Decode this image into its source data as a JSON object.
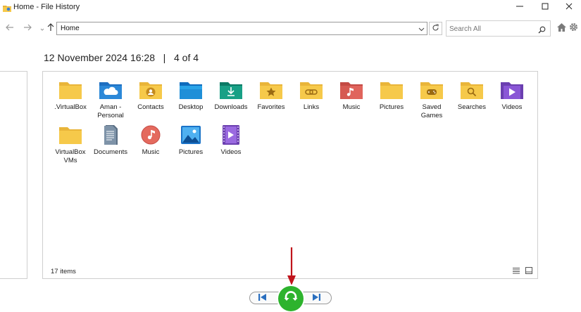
{
  "window": {
    "title": "Home - File History",
    "controls": {
      "minimize_icon": "minimize-icon",
      "maximize_icon": "maximize-icon",
      "close_icon": "close-icon"
    }
  },
  "toolbar": {
    "address_value": "Home",
    "search_placeholder": "Search All",
    "icons": [
      "back-arrow-icon",
      "forward-arrow-icon",
      "recent-chevron-icon",
      "up-arrow-icon",
      "refresh-icon",
      "search-icon",
      "home-icon",
      "gear-icon"
    ]
  },
  "backup": {
    "date": "12 November 2024 16:28",
    "separator": "|",
    "position": "4 of 4"
  },
  "items": [
    {
      "label": ".VirtualBox",
      "icon": "folder-icon"
    },
    {
      "label": "Aman - Personal",
      "icon": "onedrive-folder-icon"
    },
    {
      "label": "Contacts",
      "icon": "contacts-folder-icon"
    },
    {
      "label": "Desktop",
      "icon": "desktop-folder-icon"
    },
    {
      "label": "Downloads",
      "icon": "downloads-folder-icon"
    },
    {
      "label": "Favorites",
      "icon": "favorites-folder-icon"
    },
    {
      "label": "Links",
      "icon": "links-folder-icon"
    },
    {
      "label": "Music",
      "icon": "music-folder-icon"
    },
    {
      "label": "Pictures",
      "icon": "folder-icon"
    },
    {
      "label": "Saved Games",
      "icon": "saved-games-folder-icon"
    },
    {
      "label": "Searches",
      "icon": "searches-folder-icon"
    },
    {
      "label": "Videos",
      "icon": "videos-folder-icon"
    },
    {
      "label": "VirtualBox VMs",
      "icon": "folder-icon"
    },
    {
      "label": "Documents",
      "icon": "documents-library-icon"
    },
    {
      "label": "Music",
      "icon": "music-library-icon"
    },
    {
      "label": "Pictures",
      "icon": "pictures-library-icon"
    },
    {
      "label": "Videos",
      "icon": "videos-library-icon"
    }
  ],
  "status": {
    "item_count": "17 items"
  },
  "playback": {
    "previous_icon": "previous-version-icon",
    "restore_icon": "restore-icon",
    "next_icon": "next-version-icon",
    "restore_color": "#2db32d"
  },
  "colors": {
    "folder": "#f6c94a",
    "folder_dark": "#e9b53a",
    "annotation_arrow": "#c0141c"
  }
}
